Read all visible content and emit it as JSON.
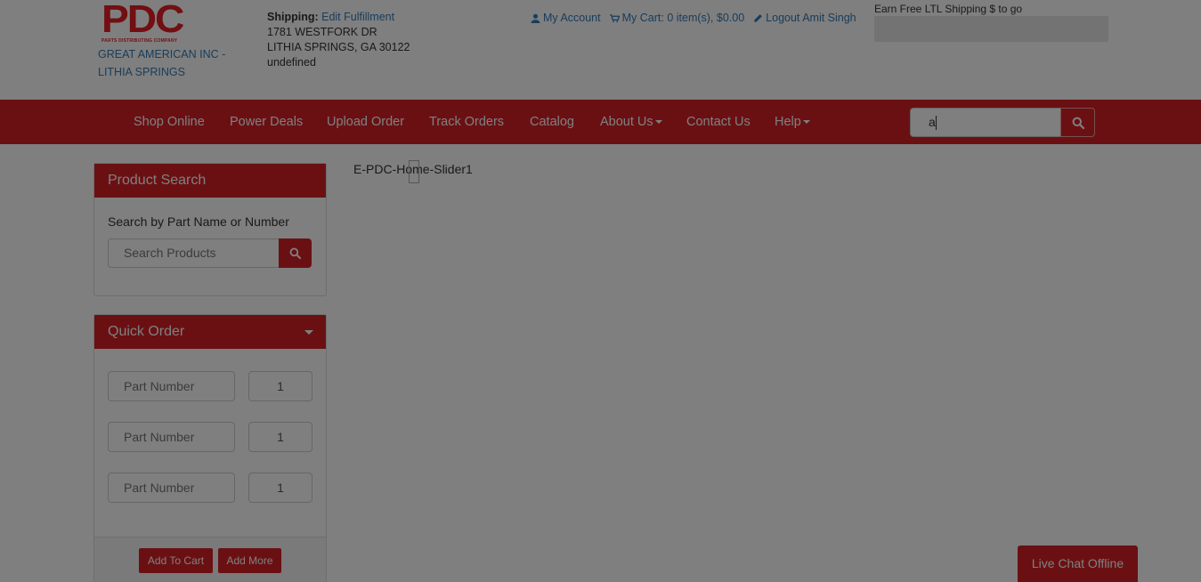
{
  "header": {
    "logo": {
      "letters": "PDC",
      "tagline": "PARTS DISTRIBUTING COMPANY"
    },
    "company_line1": "GREAT AMERICAN INC -",
    "company_line2": "LITHIA SPRINGS",
    "shipping": {
      "label": "Shipping:",
      "edit_link": "Edit Fulfillment",
      "address1": "1781 WESTFORK DR",
      "address2": "LITHIA SPRINGS, GA 30122",
      "address3": "undefined"
    },
    "account_links": {
      "my_account": "My Account",
      "cart": "My Cart: 0 item(s), $0.00",
      "logout": "Logout Amit Singh"
    },
    "ltl_text": "Earn Free LTL Shipping $ to go"
  },
  "navbar": {
    "items": [
      {
        "label": "Shop Online"
      },
      {
        "label": "Power Deals"
      },
      {
        "label": "Upload Order"
      },
      {
        "label": "Track Orders"
      },
      {
        "label": "Catalog"
      },
      {
        "label": "About Us"
      },
      {
        "label": "Contact Us"
      },
      {
        "label": "Help"
      }
    ],
    "search_value": "a"
  },
  "product_search": {
    "title": "Product Search",
    "label": "Search by Part Name or Number",
    "placeholder": "Search Products"
  },
  "quick_order": {
    "title": "Quick Order",
    "rows": [
      {
        "part_placeholder": "Part Number",
        "qty": "1"
      },
      {
        "part_placeholder": "Part Number",
        "qty": "1"
      },
      {
        "part_placeholder": "Part Number",
        "qty": "1"
      }
    ],
    "add_to_cart": "Add To Cart",
    "add_more": "Add More"
  },
  "main": {
    "slider_label": "E-PDC-Home-Slider1"
  },
  "chat": {
    "label": "Live Chat Offline"
  },
  "colors": {
    "brand_red": "#d42027",
    "link_blue": "#337ab7",
    "overlay": "rgba(0,0,0,0.5)"
  }
}
